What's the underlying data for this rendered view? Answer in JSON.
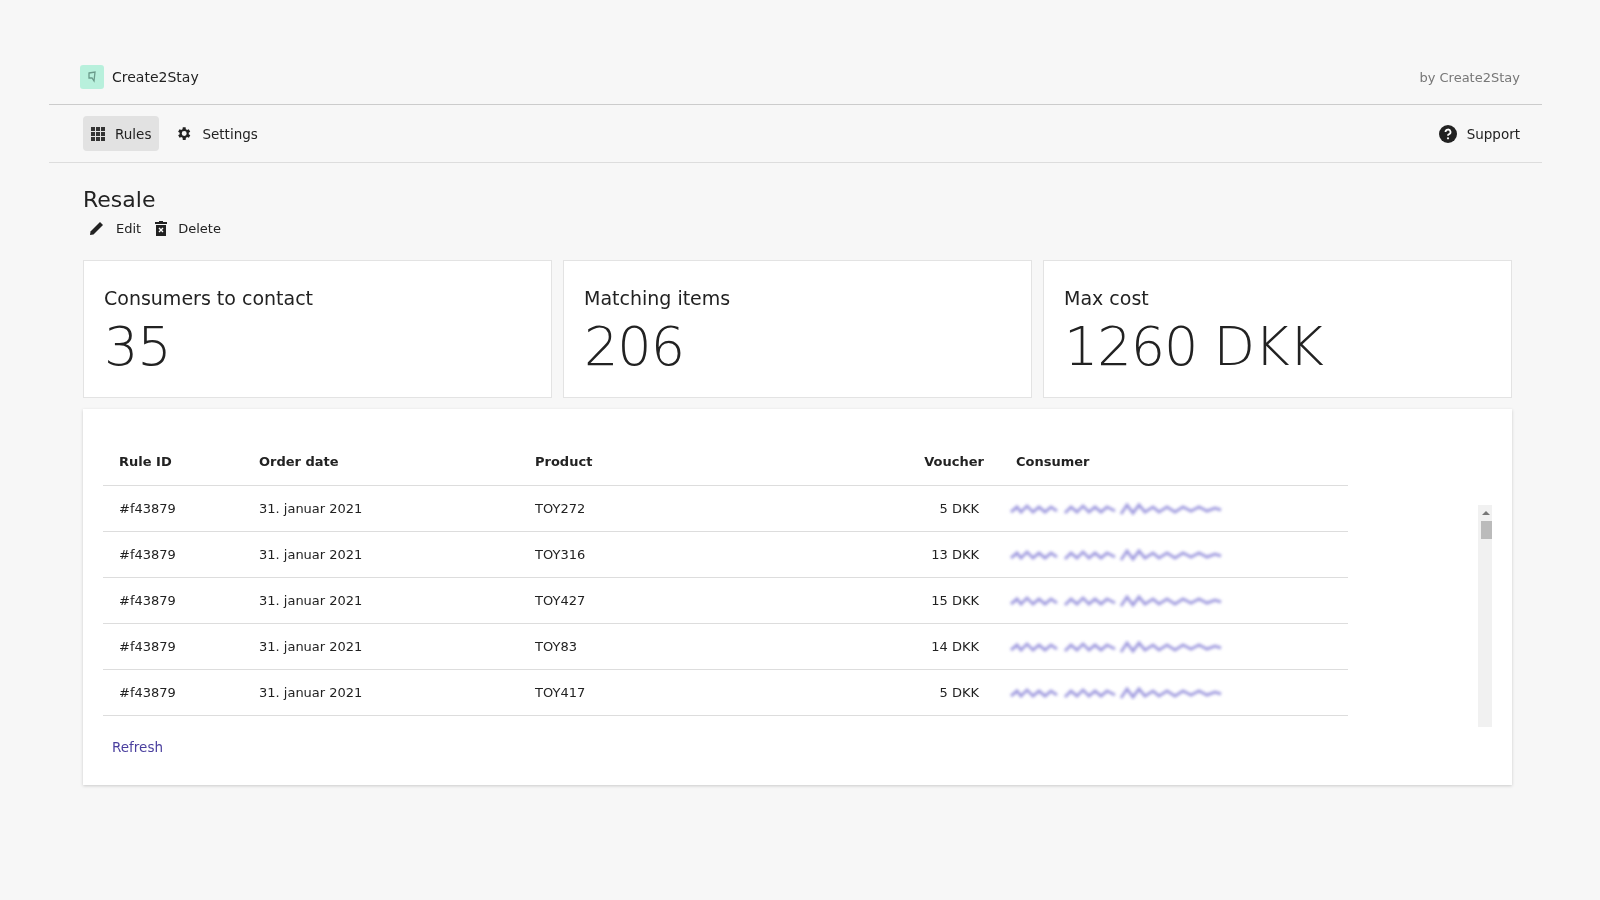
{
  "header": {
    "app_name": "Create2Stay",
    "byline": "by Create2Stay"
  },
  "nav": {
    "items": [
      {
        "label": "Rules",
        "selected": true
      },
      {
        "label": "Settings",
        "selected": false
      }
    ],
    "support": "Support"
  },
  "page": {
    "title": "Resale",
    "actions": [
      "Edit",
      "Delete"
    ]
  },
  "stats": [
    {
      "label": "Consumers to contact",
      "value": "35"
    },
    {
      "label": "Matching items",
      "value": "206"
    },
    {
      "label": "Max cost",
      "value": "1260 DKK"
    }
  ],
  "table": {
    "columns": [
      "Rule ID",
      "Order date",
      "Product",
      "Voucher",
      "Consumer"
    ],
    "rows": [
      {
        "rule_id": "#f43879",
        "order_date": "31. januar 2021",
        "product": "TOY272",
        "voucher": "5 DKK"
      },
      {
        "rule_id": "#f43879",
        "order_date": "31. januar 2021",
        "product": "TOY316",
        "voucher": "13 DKK"
      },
      {
        "rule_id": "#f43879",
        "order_date": "31. januar 2021",
        "product": "TOY427",
        "voucher": "15 DKK"
      },
      {
        "rule_id": "#f43879",
        "order_date": "31. januar 2021",
        "product": "TOY83",
        "voucher": "14 DKK"
      },
      {
        "rule_id": "#f43879",
        "order_date": "31. januar 2021",
        "product": "TOY417",
        "voucher": "5 DKK"
      }
    ]
  },
  "refresh": "Refresh"
}
